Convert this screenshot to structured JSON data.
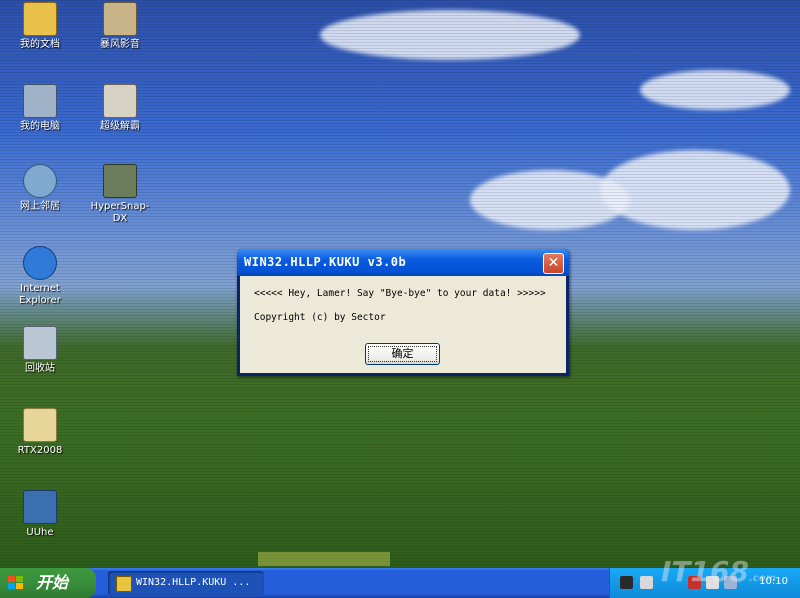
{
  "dialog": {
    "title": "WIN32.HLLP.KUKU v3.0b",
    "message": "<<<<< Hey, Lamer! Say \"Bye-bye\" to your data! >>>>>",
    "copyright": "Copyright (c) by Sector",
    "ok_label": "确定",
    "close_glyph": "✕"
  },
  "desktop_icons": [
    {
      "label": "我的文档"
    },
    {
      "label": "我的电脑"
    },
    {
      "label": "网上邻居"
    },
    {
      "label": "Internet Explorer"
    },
    {
      "label": "回收站"
    },
    {
      "label": "RTX2008"
    },
    {
      "label": "UUhe"
    },
    {
      "label": "暴风影音"
    },
    {
      "label": "超级解霸"
    },
    {
      "label": "HyperSnap-DX"
    }
  ],
  "taskbar": {
    "start_label": "开始",
    "task_label": "WIN32.HLLP.KUKU ...",
    "clock": "10:10"
  },
  "watermark": {
    "text": "IT168",
    "suffix": ".com"
  },
  "colors": {
    "titlebar": "#0453d6",
    "dialog_bg": "#ece9d8",
    "close_button": "#c9462b",
    "taskbar": "#245edb",
    "start_button": "#388e3c"
  }
}
